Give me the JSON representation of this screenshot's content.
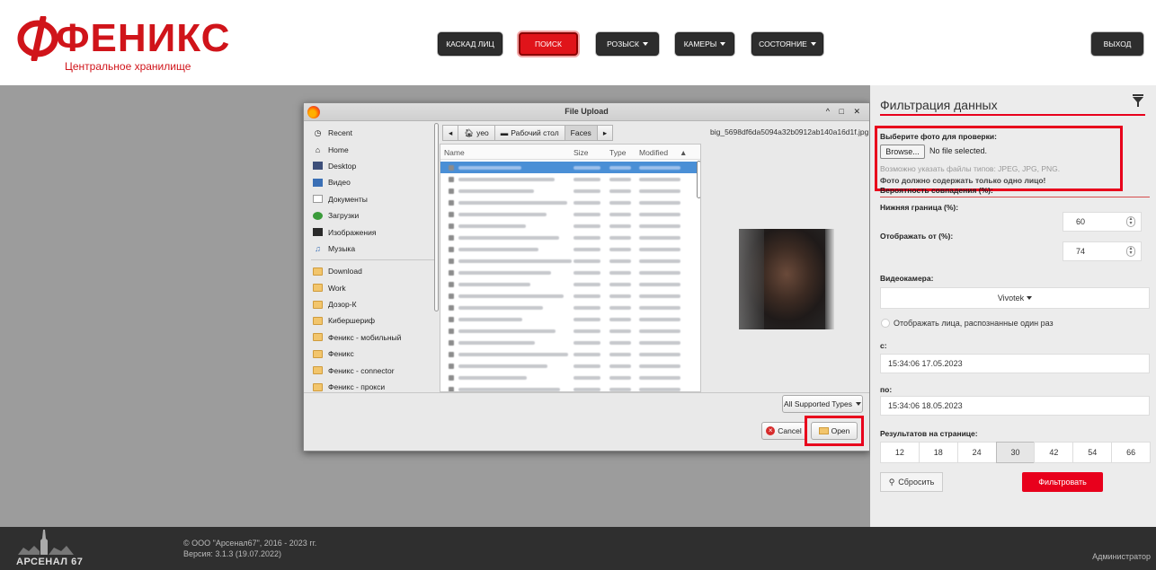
{
  "header": {
    "logo_text": "ФЕНИКС",
    "logo_subtitle": "Центральное хранилище",
    "nav": [
      {
        "label": "КАСКАД ЛИЦ",
        "dropdown": false,
        "active": false
      },
      {
        "label": "ПОИСК",
        "dropdown": false,
        "active": true
      },
      {
        "label": "РОЗЫСК",
        "dropdown": true,
        "active": false
      },
      {
        "label": "КАМЕРЫ",
        "dropdown": true,
        "active": false
      },
      {
        "label": "СОСТОЯНИЕ",
        "dropdown": true,
        "active": false
      }
    ],
    "exit_label": "ВЫХОД"
  },
  "dialog": {
    "title": "File Upload",
    "window_controls": "^ □ ✕",
    "places": [
      {
        "label": "Recent",
        "icon": "clock-icon"
      },
      {
        "label": "Home",
        "icon": "home-icon"
      },
      {
        "label": "Desktop",
        "icon": "desktop-icon"
      },
      {
        "label": "Видео",
        "icon": "video-icon"
      },
      {
        "label": "Документы",
        "icon": "document-icon"
      },
      {
        "label": "Загрузки",
        "icon": "download-icon"
      },
      {
        "label": "Изображения",
        "icon": "image-icon"
      },
      {
        "label": "Музыка",
        "icon": "music-icon"
      }
    ],
    "bookmarks": [
      "Download",
      "Work",
      "Дозор-К",
      "Кибершериф",
      "Феникс - мобильный",
      "Феникс",
      "Феникс - connector",
      "Феникс - прокси"
    ],
    "breadcrumbs": [
      "yeo",
      "Рабочий стол",
      "Faces"
    ],
    "columns": {
      "name": "Name",
      "size": "Size",
      "type": "Type",
      "modified": "Modified"
    },
    "preview_filename": "big_5698df6da5094a32b0912ab140a16d1f.jpg",
    "file_types": "All Supported Types",
    "cancel_label": "Cancel",
    "open_label": "Open"
  },
  "panel": {
    "title": "Фильтрация данных",
    "photo_label": "Выберите фото для проверки:",
    "browse_label": "Browse...",
    "no_file": "No file selected.",
    "hint_types": "Возможно указать файлы типов: JPEG, JPG, PNG.",
    "hint_one_face": "Фото должно содержать только одно лицо!",
    "probability_label": "Вероятность совпадения (%):",
    "lower_label": "Нижняя граница (%):",
    "lower_value": "60",
    "display_from_label": "Отображать от (%):",
    "display_from_value": "74",
    "camera_label": "Видеокамера:",
    "camera_value": "Vivotek",
    "once_label": "Отображать лица, распознанные один раз",
    "from_label": "с:",
    "from_value": "15:34:06 17.05.2023",
    "to_label": "по:",
    "to_value": "15:34:06 18.05.2023",
    "per_page_label": "Результатов на странице:",
    "per_page_options": [
      "12",
      "18",
      "24",
      "30",
      "42",
      "54",
      "66"
    ],
    "per_page_selected": "30",
    "reset_label": "Сбросить",
    "filter_label": "Фильтровать"
  },
  "footer": {
    "brand": "АРСЕНАЛ 67",
    "copyright": "© ООО \"Арсенал67\", 2016 - 2023 гг.",
    "version": "Версия: 3.1.3 (19.07.2022)",
    "user": "Администратор"
  },
  "colors": {
    "accent": "#e8001c",
    "logo": "#d0141a",
    "nav_dark": "#2d2d2d",
    "footer": "#2f2f2f",
    "selection": "#4a8fd6"
  }
}
